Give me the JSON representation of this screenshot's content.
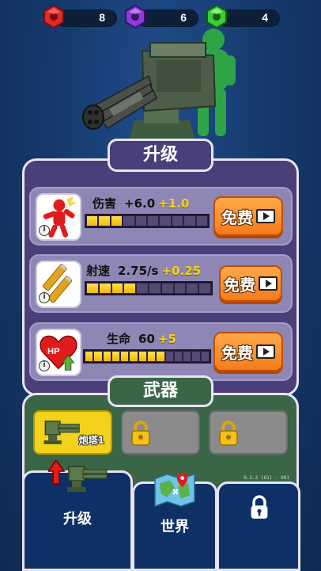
{
  "resources": [
    {
      "gem": "red-gem",
      "color": "#e02a2a",
      "count": "8"
    },
    {
      "gem": "purple-gem",
      "color": "#8a3ad6",
      "count": "6"
    },
    {
      "gem": "green-gem",
      "color": "#3ec93a",
      "count": "4"
    }
  ],
  "upgrade_title": "升级",
  "upgrades": [
    {
      "icon": "damage-icon",
      "name": "伤害",
      "value": "+6.0",
      "increase": "+1.0",
      "level": 3,
      "max": 10,
      "button": "免费"
    },
    {
      "icon": "bullets-icon",
      "name": "射速",
      "value": "2.75/s",
      "increase": "+0.25",
      "level": 4,
      "max": 10,
      "button": "免费"
    },
    {
      "icon": "hp-heart-icon",
      "name": "生命",
      "value": "60",
      "increase": "+5",
      "level": 9,
      "max": 14,
      "button": "免费"
    }
  ],
  "info_glyph": "i",
  "weapons_title": "武器",
  "weapon_slots": [
    {
      "name": "炮塔1",
      "state": "active"
    },
    {
      "name": "",
      "state": "locked"
    },
    {
      "name": "",
      "state": "locked"
    }
  ],
  "version": "0.3.2 (61) - 001",
  "nav": {
    "upgrade": "升级",
    "world": "世界",
    "locked": ""
  }
}
